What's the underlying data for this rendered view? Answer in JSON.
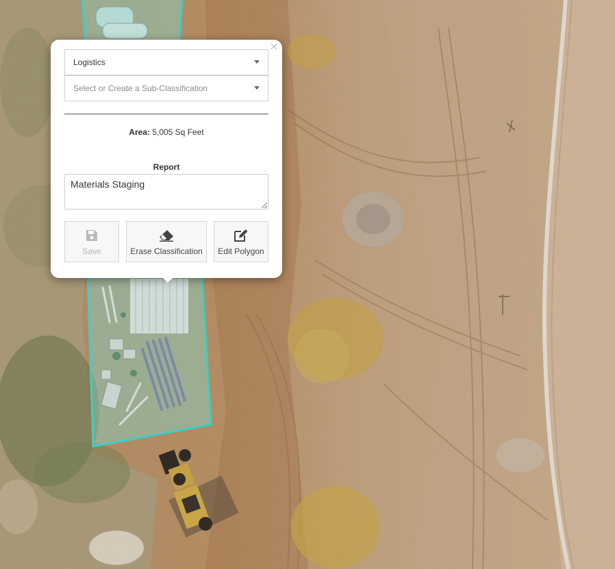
{
  "popup": {
    "close_symbol": "×",
    "classification": {
      "value": "Logistics"
    },
    "sub_classification": {
      "placeholder": "Select or Create a Sub-Classification"
    },
    "area": {
      "label": "Area:",
      "value": "5,005 Sq Feet"
    },
    "report": {
      "label": "Report",
      "value": "Materials Staging"
    },
    "buttons": {
      "save": {
        "label": "Save",
        "icon": "floppy-disk-icon",
        "disabled": true
      },
      "erase": {
        "label": "Erase Classification",
        "icon": "eraser-icon"
      },
      "edit": {
        "label": "Edit Polygon",
        "icon": "pencil-square-icon"
      }
    }
  },
  "map": {
    "polygon_outline_color": "#2fd9d4",
    "polygon_fill_color": "#7fe3dc"
  }
}
